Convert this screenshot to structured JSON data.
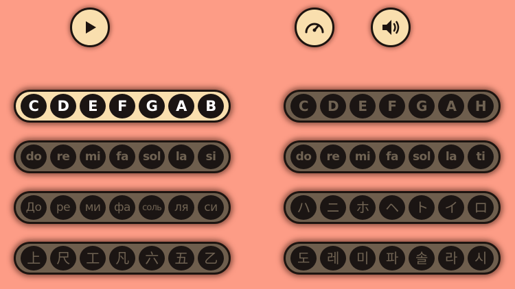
{
  "controls": {
    "play": "play-icon",
    "speed": "speedometer-icon",
    "sound": "speaker-icon"
  },
  "colors": {
    "background": "#fd9c86",
    "button_fill": "#f9dfae",
    "active_pill": "#f9dfae",
    "inactive_pill": "#6e5e4d",
    "note_dot": "#1b1513"
  },
  "notations": {
    "left": [
      {
        "id": "letters-cdefgab",
        "active": true,
        "notes": [
          "C",
          "D",
          "E",
          "F",
          "G",
          "A",
          "B"
        ]
      },
      {
        "id": "solfege-si",
        "active": false,
        "notes": [
          "do",
          "re",
          "mi",
          "fa",
          "sol",
          "la",
          "si"
        ]
      },
      {
        "id": "russian",
        "active": false,
        "notes": [
          "До",
          "ре",
          "ми",
          "фа",
          "соль",
          "ля",
          "си"
        ]
      },
      {
        "id": "chinese-gongche",
        "active": false,
        "notes": [
          "上",
          "尺",
          "工",
          "凡",
          "六",
          "五",
          "乙"
        ]
      }
    ],
    "right": [
      {
        "id": "letters-cdefgah",
        "active": false,
        "notes": [
          "C",
          "D",
          "E",
          "F",
          "G",
          "A",
          "H"
        ]
      },
      {
        "id": "solfege-ti",
        "active": false,
        "notes": [
          "do",
          "re",
          "mi",
          "fa",
          "sol",
          "la",
          "ti"
        ]
      },
      {
        "id": "japanese-iroha",
        "active": false,
        "notes": [
          "ハ",
          "ニ",
          "ホ",
          "ヘ",
          "ト",
          "イ",
          "ロ"
        ]
      },
      {
        "id": "korean",
        "active": false,
        "notes": [
          "도",
          "레",
          "미",
          "파",
          "솔",
          "라",
          "시"
        ]
      }
    ]
  }
}
